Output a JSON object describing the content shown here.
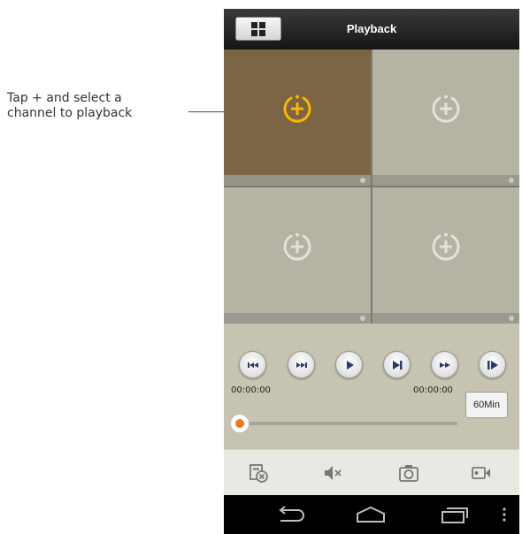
{
  "annotation": {
    "callout_line1": "Tap + and select a",
    "callout_line2": "channel to playback"
  },
  "header": {
    "title": "Playback",
    "menu_icon": "grid-icon"
  },
  "channels": [
    {
      "slot": 1,
      "state": "selected",
      "icon": "add-channel-icon"
    },
    {
      "slot": 2,
      "state": "empty",
      "icon": "add-channel-icon"
    },
    {
      "slot": 3,
      "state": "empty",
      "icon": "add-channel-icon"
    },
    {
      "slot": 4,
      "state": "empty",
      "icon": "add-channel-icon"
    }
  ],
  "playback": {
    "buttons": [
      "skip-to-start-icon",
      "previous-frame-icon",
      "play-icon",
      "next-frame-icon",
      "fast-forward-icon",
      "slow-play-icon"
    ],
    "start_time": "00:00:00",
    "end_time": "00:00:00",
    "duration_label": "60Min",
    "progress": 0
  },
  "toolbar": {
    "icons": [
      "close-all-icon",
      "mute-icon",
      "snapshot-icon",
      "record-icon"
    ]
  },
  "navigation": {
    "icons": [
      "back-icon",
      "home-icon",
      "recent-apps-icon",
      "overflow-menu-icon"
    ]
  },
  "colors": {
    "accent": "#ffb400",
    "progress_thumb": "#ea7b1c",
    "selected_tile": "#7c6544"
  }
}
